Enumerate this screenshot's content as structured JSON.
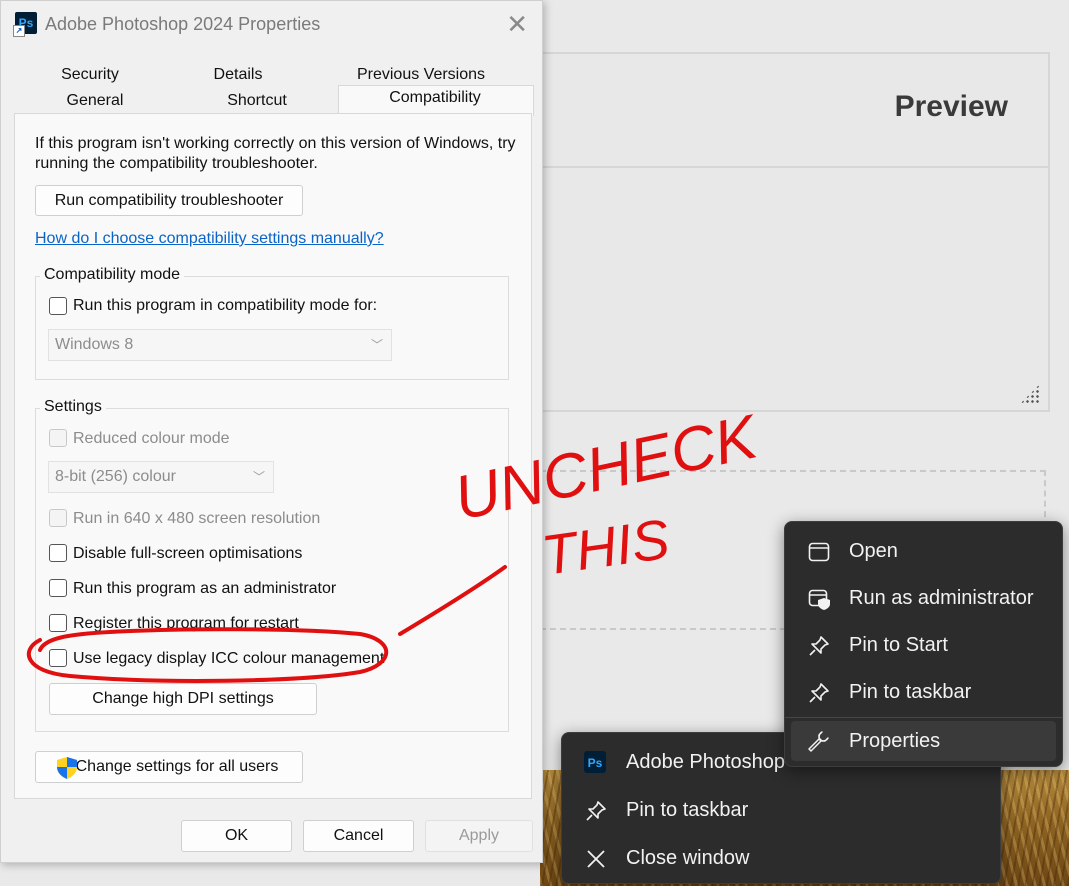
{
  "background": {
    "preview_title": "Preview"
  },
  "dialog": {
    "title": "Adobe Photoshop 2024 Properties",
    "app_icon_text": "Ps",
    "close_glyph": "✕",
    "tabs_top": [
      "Security",
      "Details",
      "Previous Versions"
    ],
    "tabs_bottom": [
      "General",
      "Shortcut",
      "Compatibility"
    ],
    "selected_tab": "Compatibility",
    "intro_line1": "If this program isn't working correctly on this version of Windows, try",
    "intro_line2": "running the compatibility troubleshooter.",
    "troubleshooter_button": "Run compatibility troubleshooter",
    "help_link": "How do I choose compatibility settings manually?",
    "compat_mode": {
      "label": "Compatibility mode",
      "checkbox": "Run this program in compatibility mode for:",
      "select_value": "Windows 8"
    },
    "settings": {
      "label": "Settings",
      "reduced_colour": "Reduced colour mode",
      "colour_select": "8-bit (256) colour",
      "resolution_640": "Run in 640 x 480 screen resolution",
      "disable_fullscreen": "Disable full-screen optimisations",
      "run_as_admin": "Run this program as an administrator",
      "register_restart": "Register this program for restart",
      "legacy_icc": "Use legacy display ICC colour management",
      "dpi_button": "Change high DPI settings"
    },
    "all_users_button": "Change settings for all users",
    "ok": "OK",
    "cancel": "Cancel",
    "apply": "Apply"
  },
  "context_menu": {
    "items": [
      {
        "label": "Open",
        "icon": "window-icon"
      },
      {
        "label": "Run as administrator",
        "icon": "shield-window-icon"
      },
      {
        "label": "Pin to Start",
        "icon": "pin-icon"
      },
      {
        "label": "Pin to taskbar",
        "icon": "pin-icon"
      },
      {
        "label": "Properties",
        "icon": "wrench-icon"
      }
    ]
  },
  "taskbar_menu": {
    "app_icon_text": "Ps",
    "app_label": "Adobe Photoshop",
    "pin_label": "Pin to taskbar",
    "close_label": "Close window"
  },
  "annotation": {
    "line1": "UNCHECK",
    "line2": "THIS",
    "color": "#e01010"
  },
  "colors": {
    "link": "#0a64c8",
    "menu_bg": "#2c2c2c",
    "ps_blue": "#31a8ff",
    "ps_dark": "#001e36"
  }
}
